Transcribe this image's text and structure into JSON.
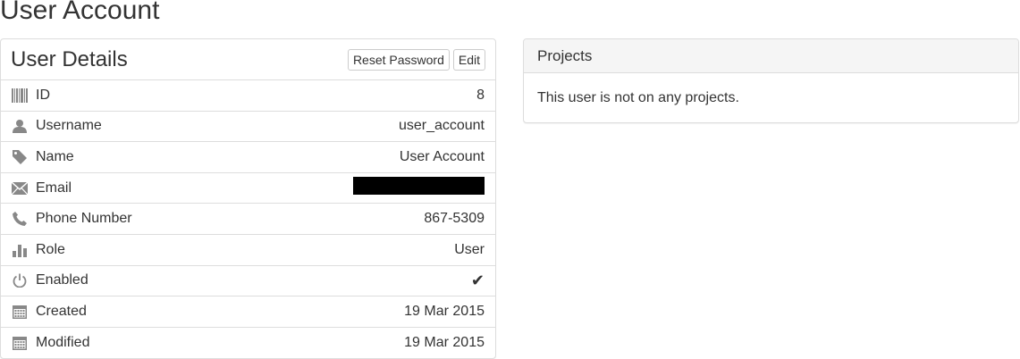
{
  "page": {
    "title": "User Account"
  },
  "details": {
    "title": "User Details",
    "buttons": {
      "reset_password": "Reset Password",
      "edit": "Edit"
    },
    "rows": [
      {
        "icon": "barcode-icon",
        "label": "ID",
        "value": "8"
      },
      {
        "icon": "user-icon",
        "label": "Username",
        "value": "user_account"
      },
      {
        "icon": "tag-icon",
        "label": "Name",
        "value": "User Account"
      },
      {
        "icon": "envelope-icon",
        "label": "Email",
        "value": ""
      },
      {
        "icon": "phone-icon",
        "label": "Phone Number",
        "value": "867-5309"
      },
      {
        "icon": "stats-icon",
        "label": "Role",
        "value": "User"
      },
      {
        "icon": "power-icon",
        "label": "Enabled",
        "value": "✔"
      },
      {
        "icon": "calendar-icon",
        "label": "Created",
        "value": "19 Mar 2015"
      },
      {
        "icon": "calendar-icon",
        "label": "Modified",
        "value": "19 Mar 2015"
      }
    ]
  },
  "projects": {
    "title": "Projects",
    "empty_message": "This user is not on any projects."
  },
  "colors": {
    "icon": "#888888",
    "border": "#dddddd",
    "header_bg": "#f5f5f5",
    "text": "#333333",
    "redacted": "#000000"
  }
}
